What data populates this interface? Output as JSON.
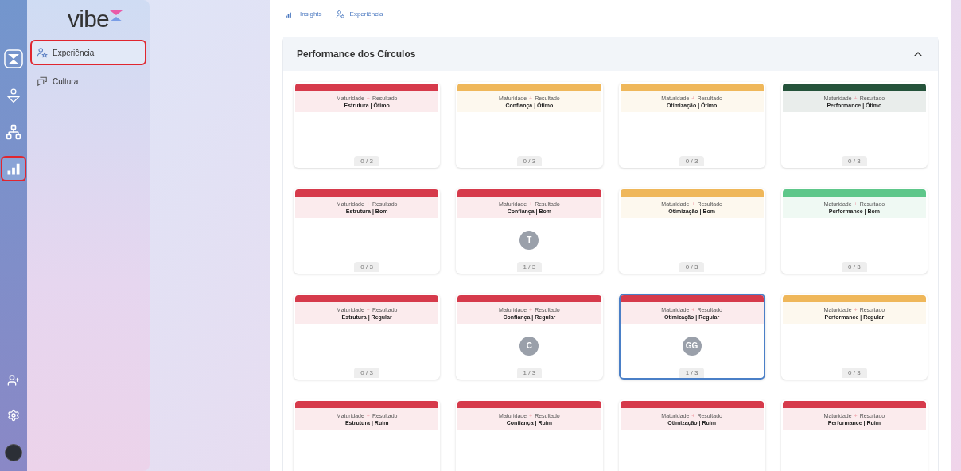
{
  "rail": {
    "items": [
      {
        "kind": "logo",
        "selected": false
      },
      {
        "kind": "ai-person",
        "selected": false
      },
      {
        "kind": "network",
        "selected": false
      },
      {
        "kind": "chart",
        "selected": true
      }
    ],
    "bottom": [
      {
        "kind": "add-user"
      },
      {
        "kind": "settings"
      }
    ]
  },
  "sidebar": {
    "logo": "vibe",
    "items": [
      {
        "label": "Experiência",
        "selected": true
      },
      {
        "label": "Cultura",
        "selected": false
      }
    ]
  },
  "breadcrumb": [
    "Insights",
    "Experiência"
  ],
  "section": {
    "title": "Performance dos Círculos",
    "expanded": true,
    "cards": [
      {
        "subtitle_a": "Maturidade",
        "plus": "+",
        "subtitle_b": "Resultado",
        "title": "Estrutura | Ótimo",
        "color": "#d63a4b",
        "count": "0 / 3",
        "selected": false
      },
      {
        "subtitle_a": "Maturidade",
        "plus": "+",
        "subtitle_b": "Resultado",
        "title": "Confiança | Ótimo",
        "color": "#efb75a",
        "count": "0 / 3",
        "selected": false
      },
      {
        "subtitle_a": "Maturidade",
        "plus": "+",
        "subtitle_b": "Resultado",
        "title": "Otimização | Ótimo",
        "color": "#efb75a",
        "count": "0 / 3",
        "selected": false
      },
      {
        "subtitle_a": "Maturidade",
        "plus": "+",
        "subtitle_b": "Resultado",
        "title": "Performance | Ótimo",
        "color": "#24523a",
        "count": "0 / 3",
        "selected": false
      },
      {
        "subtitle_a": "Maturidade",
        "plus": "+",
        "subtitle_b": "Resultado",
        "title": "Estrutura | Bom",
        "color": "#d63a4b",
        "count": "0 / 3",
        "selected": false
      },
      {
        "subtitle_a": "Maturidade",
        "plus": "+",
        "subtitle_b": "Resultado",
        "title": "Confiança | Bom",
        "color": "#d63a4b",
        "count": "1 / 3",
        "avatar": "T",
        "selected": false
      },
      {
        "subtitle_a": "Maturidade",
        "plus": "+",
        "subtitle_b": "Resultado",
        "title": "Otimização | Bom",
        "color": "#efb75a",
        "count": "0 / 3",
        "selected": false
      },
      {
        "subtitle_a": "Maturidade",
        "plus": "+",
        "subtitle_b": "Resultado",
        "title": "Performance | Bom",
        "color": "#5ec78a",
        "count": "0 / 3",
        "selected": false
      },
      {
        "subtitle_a": "Maturidade",
        "plus": "+",
        "subtitle_b": "Resultado",
        "title": "Estrutura | Regular",
        "color": "#d63a4b",
        "count": "0 / 3",
        "selected": false
      },
      {
        "subtitle_a": "Maturidade",
        "plus": "+",
        "subtitle_b": "Resultado",
        "title": "Confiança | Regular",
        "color": "#d63a4b",
        "count": "1 / 3",
        "avatar": "C",
        "selected": false
      },
      {
        "subtitle_a": "Maturidade",
        "plus": "+",
        "subtitle_b": "Resultado",
        "title": "Otimização | Regular",
        "color": "#d63a4b",
        "count": "1 / 3",
        "avatar": "GG",
        "selected": true
      },
      {
        "subtitle_a": "Maturidade",
        "plus": "+",
        "subtitle_b": "Resultado",
        "title": "Performance | Regular",
        "color": "#efb75a",
        "count": "0 / 3",
        "selected": false
      },
      {
        "subtitle_a": "Maturidade",
        "plus": "+",
        "subtitle_b": "Resultado",
        "title": "Estrutura | Ruim",
        "color": "#d63a4b",
        "selected": false
      },
      {
        "subtitle_a": "Maturidade",
        "plus": "+",
        "subtitle_b": "Resultado",
        "title": "Confiança | Ruim",
        "color": "#d63a4b",
        "selected": false
      },
      {
        "subtitle_a": "Maturidade",
        "plus": "+",
        "subtitle_b": "Resultado",
        "title": "Otimização | Ruim",
        "color": "#d63a4b",
        "selected": false
      },
      {
        "subtitle_a": "Maturidade",
        "plus": "+",
        "subtitle_b": "Resultado",
        "title": "Performance | Ruim",
        "color": "#d63a4b",
        "selected": false
      }
    ]
  }
}
